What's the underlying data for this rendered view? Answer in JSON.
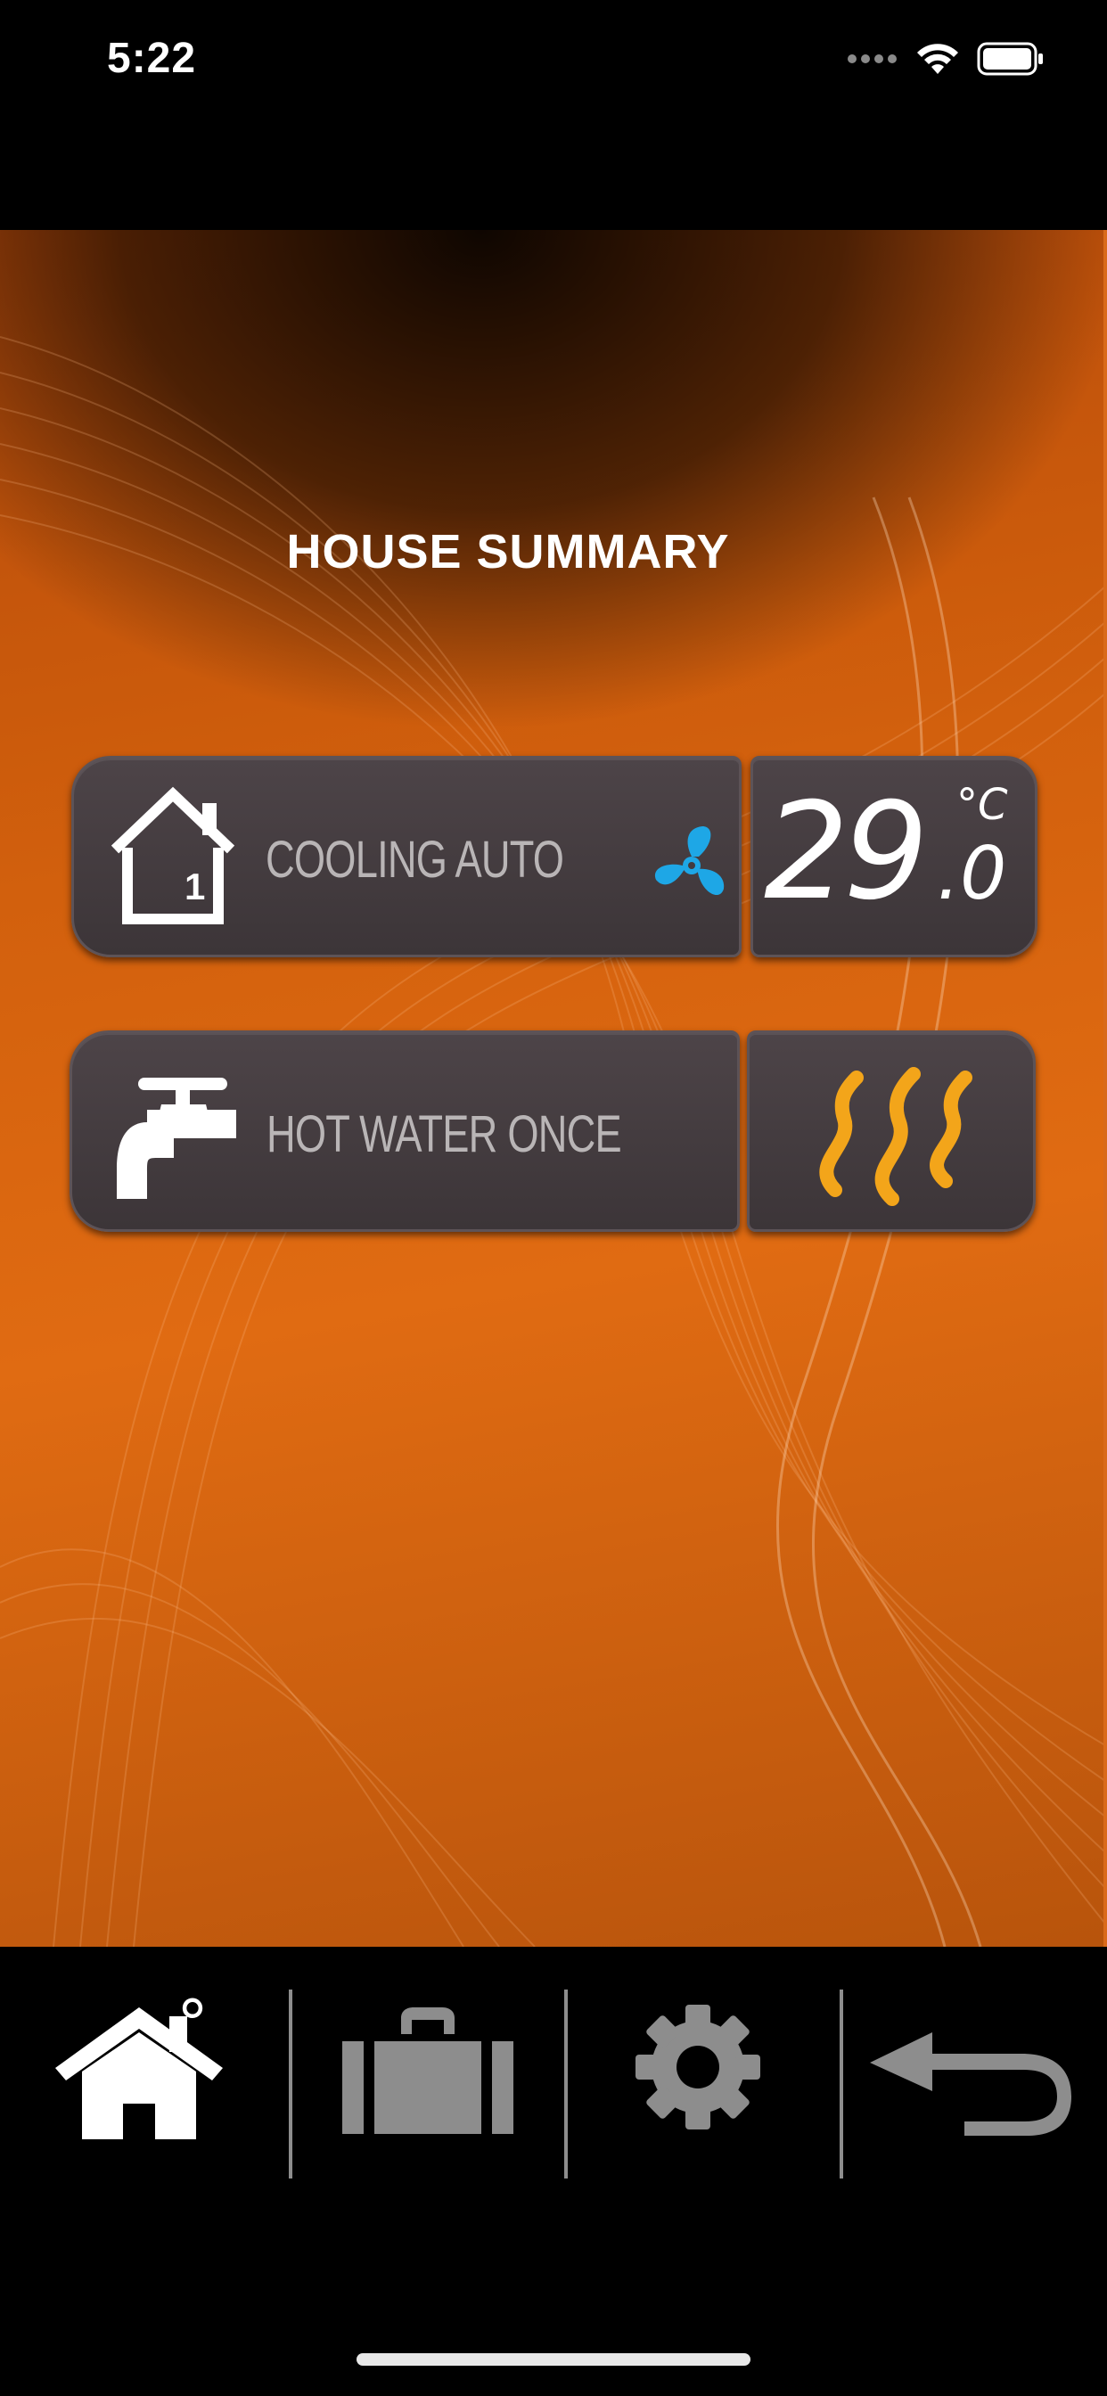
{
  "status_bar": {
    "time": "5:22",
    "icons": [
      "signal-dots-icon",
      "wifi-icon",
      "battery-icon"
    ]
  },
  "page": {
    "title": "HOUSE SUMMARY"
  },
  "zones": [
    {
      "icon": "house-zone-1-icon",
      "zone_number": "1",
      "label": "COOLING AUTO",
      "mode_icon": "fan-icon",
      "temperature": {
        "integer": "29",
        "decimal": ".0",
        "unit": "°C"
      }
    },
    {
      "icon": "tap-icon",
      "label": "HOT WATER ONCE",
      "status_icon": "heat-waves-icon"
    }
  ],
  "bottom_nav": {
    "items": [
      {
        "name": "home-icon",
        "badge": "°",
        "active": true
      },
      {
        "name": "briefcase-icon",
        "active": false
      },
      {
        "name": "gear-icon",
        "active": false
      },
      {
        "name": "back-arrow-icon",
        "active": false
      }
    ]
  },
  "colors": {
    "background_orange": "#e06b12",
    "panel": "#433b3e",
    "fan_blue": "#1ea7e6",
    "heat_amber": "#f3a51a",
    "label_grey": "#b9b5b6",
    "nav_inactive": "#8d8d8d"
  }
}
